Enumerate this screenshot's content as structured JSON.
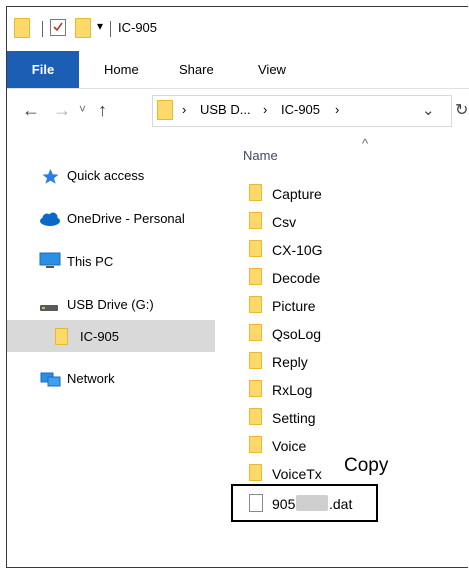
{
  "window": {
    "title": "IC-905",
    "quick_access_chevron": "▾"
  },
  "ribbon": {
    "tabs": [
      "File",
      "Home",
      "Share",
      "View"
    ]
  },
  "nav": {
    "back": "←",
    "forward": "→",
    "recent": "˅",
    "up": "↑",
    "breadcrumb_sep": "›",
    "path_root": "USB D...",
    "path_folder": "IC-905",
    "dropdown": "⌄",
    "refresh": "↻"
  },
  "sidebar": {
    "items": [
      {
        "label": "Quick access"
      },
      {
        "label": "OneDrive - Personal"
      },
      {
        "label": "This PC"
      },
      {
        "label": "USB Drive (G:)"
      },
      {
        "label": "IC-905"
      },
      {
        "label": "Network"
      }
    ]
  },
  "main": {
    "column_header": "Name",
    "sort_indicator": "^",
    "folders": [
      "Capture",
      "Csv",
      "CX-10G",
      "Decode",
      "Picture",
      "QsoLog",
      "Reply",
      "RxLog",
      "Setting",
      "Voice",
      "VoiceTx"
    ],
    "file": {
      "prefix": "905",
      "suffix": ".dat"
    }
  },
  "annotation": {
    "copy_label": "Copy"
  },
  "colors": {
    "accent": "#1a5fb4",
    "folder": "#fcd96a",
    "selection": "#d9d9d9"
  }
}
